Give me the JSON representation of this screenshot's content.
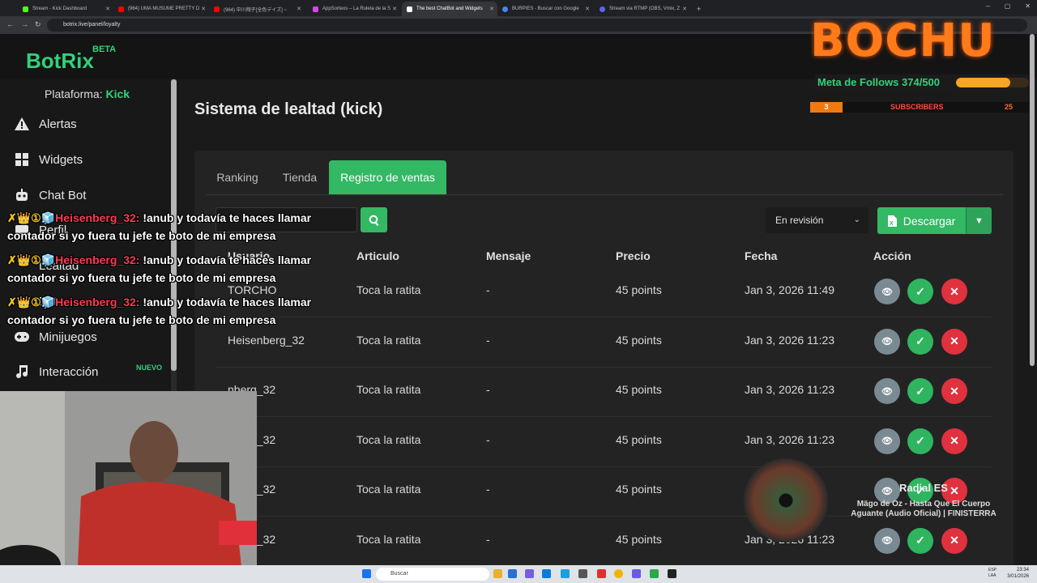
{
  "browser": {
    "tabs": [
      {
        "label": "Stream - Kick Dashboard",
        "color": "#53fc18"
      },
      {
        "label": "(964) UMA MUSUME PRETTY D",
        "color": "#ff0000"
      },
      {
        "label": "(964) 中川翔子[全色デイズ] ~",
        "color": "#ff0000"
      },
      {
        "label": "AppSorteos – La Ruleta de la S",
        "color": "#e040fb"
      },
      {
        "label": "The best ChatBot and Widgets",
        "color": "#ffffff"
      },
      {
        "label": "BURPIES - Buscar con Google",
        "color": "#4285f4"
      },
      {
        "label": "Stream via RTMP (OBS, Vmix, Z",
        "color": "#5865f2"
      }
    ],
    "url": "botrix.live/panel/loyalty"
  },
  "app": {
    "logo": "BotRix",
    "beta": "BETA",
    "platform_label": "Plataforma:",
    "platform_value": "Kick",
    "nav": {
      "alertas": "Alertas",
      "widgets": "Widgets",
      "chatbot": "Chat Bot",
      "perfil": "Perfil",
      "lealtad": "Lealtad",
      "bot": "Bot",
      "minijuegos": "Minijuegos",
      "interaccion": "Interacción",
      "nuevo_badge": "NUEVO"
    },
    "page_title": "Sistema de lealtad (kick)",
    "tabs": {
      "ranking": "Ranking",
      "tienda": "Tienda",
      "registro": "Registro de ventas"
    },
    "status_select": "En revisión",
    "download": "Descargar",
    "columns": {
      "usuario": "Usuario",
      "articulo": "Articulo",
      "mensaje": "Mensaje",
      "precio": "Precio",
      "fecha": "Fecha",
      "accion": "Acción"
    },
    "rows": [
      {
        "usuario": "TORCHO",
        "articulo": "Toca la ratita",
        "mensaje": "-",
        "precio": "45 points",
        "fecha": "Jan 3, 2026 11:49"
      },
      {
        "usuario": "Heisenberg_32",
        "articulo": "Toca la ratita",
        "mensaje": "-",
        "precio": "45 points",
        "fecha": "Jan 3, 2026 11:23"
      },
      {
        "usuario": "nberg_32",
        "articulo": "Toca la ratita",
        "mensaje": "-",
        "precio": "45 points",
        "fecha": "Jan 3, 2026 11:23"
      },
      {
        "usuario": "nberg_32",
        "articulo": "Toca la ratita",
        "mensaje": "-",
        "precio": "45 points",
        "fecha": "Jan 3, 2026 11:23"
      },
      {
        "usuario": "nberg_32",
        "articulo": "Toca la ratita",
        "mensaje": "-",
        "precio": "45 points",
        "fecha": ""
      },
      {
        "usuario": "nberg_32",
        "articulo": "Toca la ratita",
        "mensaje": "-",
        "precio": "45 points",
        "fecha": "Jan 3, 2026 11:23"
      }
    ]
  },
  "overlay": {
    "brand": "BOCHU",
    "follows_label": "Meta de Follows 374/500",
    "follows_progress": 0.748,
    "subs_left": "3",
    "subs_label": "SUBSCRIBERS",
    "subs_right": "25",
    "chat": [
      {
        "badges": "✗👑①🧊",
        "user": "Heisenberg_32:",
        "msg": "!anub y todavía te haces llamar",
        "line2": "contador si yo fuera tu jefe te boto de mi empresa"
      },
      {
        "badges": "✗👑①🧊",
        "user": "Heisenberg_32:",
        "msg": "!anub y todavía te haces llamar",
        "line2": "contador si yo fuera tu jefe te boto de mi empresa"
      },
      {
        "badges": "✗👑①🧊",
        "user": "Heisenberg_32:",
        "msg": "!anub y todavía te haces llamar",
        "line2": "contador si yo fuera tu jefe te boto de mi empresa"
      }
    ],
    "music_title": "Radial ES",
    "music_track": "Mägo de Oz - Hasta Que El Cuerpo Aguante (Audio Oficial) | FINISTERRA"
  },
  "taskbar": {
    "search": "Buscar",
    "lang": "ESP\nLAA",
    "time": "23:34",
    "date": "3/01/2026"
  }
}
